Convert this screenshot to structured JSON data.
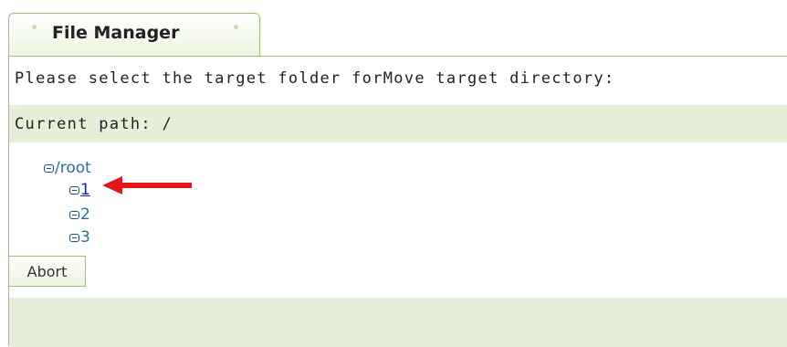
{
  "tab": {
    "title": "File Manager"
  },
  "dialog": {
    "instruction": "Please select the target folder forMove target directory:",
    "current_path": "Current path: /"
  },
  "tree": {
    "root": {
      "label": "/root"
    },
    "children": [
      {
        "label": "1",
        "link": true
      },
      {
        "label": "2",
        "link": false
      },
      {
        "label": "3",
        "link": false
      }
    ]
  },
  "footer": {
    "abort_label": "Abort"
  },
  "colors": {
    "accent_border": "#9cc36b",
    "bar_background": "#e6efd8",
    "link": "#1a1ad8",
    "tree_text": "#2b6fa0",
    "annotation_arrow": "#e8141c"
  },
  "icons": {
    "tree_toggle": "collapse-minus-icon",
    "annotation": "red-arrow-left-icon"
  }
}
